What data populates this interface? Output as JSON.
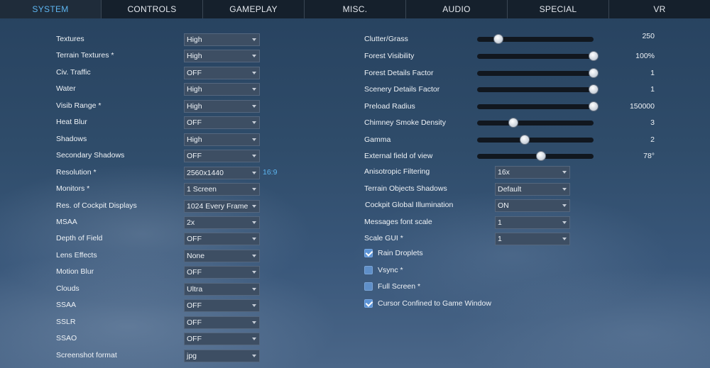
{
  "tabs": [
    "SYSTEM",
    "CONTROLS",
    "GAMEPLAY",
    "MISC.",
    "AUDIO",
    "SPECIAL",
    "VR"
  ],
  "left_options": [
    {
      "label": "Textures",
      "value": "High"
    },
    {
      "label": "Terrain Textures *",
      "value": "High"
    },
    {
      "label": "Civ. Traffic",
      "value": "OFF"
    },
    {
      "label": "Water",
      "value": "High"
    },
    {
      "label": "Visib Range *",
      "value": "High"
    },
    {
      "label": "Heat Blur",
      "value": "OFF"
    },
    {
      "label": "Shadows",
      "value": "High"
    },
    {
      "label": "Secondary Shadows",
      "value": "OFF"
    },
    {
      "label": "Resolution *",
      "value": "2560x1440"
    },
    {
      "label": "Monitors *",
      "value": "1 Screen"
    },
    {
      "label": "Res. of Cockpit Displays",
      "value": "1024 Every Frame"
    },
    {
      "label": "MSAA",
      "value": "2x"
    },
    {
      "label": "Depth of Field",
      "value": "OFF"
    },
    {
      "label": "Lens Effects",
      "value": "None"
    },
    {
      "label": "Motion Blur",
      "value": "OFF"
    },
    {
      "label": "Clouds",
      "value": "Ultra"
    },
    {
      "label": "SSAA",
      "value": "OFF"
    },
    {
      "label": "SSLR",
      "value": "OFF"
    },
    {
      "label": "SSAO",
      "value": "OFF"
    },
    {
      "label": "Screenshot format",
      "value": "jpg"
    }
  ],
  "aspect_ratio": "16:9",
  "sliders": [
    {
      "label": "Clutter/Grass",
      "value": "250",
      "level": 0.18
    },
    {
      "label": "Forest Visibility",
      "value": "100%",
      "level": 1.0
    },
    {
      "label": "Forest Details Factor",
      "value": "1",
      "level": 1.0
    },
    {
      "label": "Scenery Details Factor",
      "value": "1",
      "level": 1.0
    },
    {
      "label": "Preload Radius",
      "value": "150000",
      "level": 1.0
    },
    {
      "label": "Chimney Smoke Density",
      "value": "3",
      "level": 0.31
    },
    {
      "label": "Gamma",
      "value": "2",
      "level": 0.41
    },
    {
      "label": "External field of view",
      "value": "78°",
      "level": 0.55
    }
  ],
  "right_options": [
    {
      "label": "Anisotropic Filtering",
      "value": "16x"
    },
    {
      "label": "Terrain Objects Shadows",
      "value": "Default"
    },
    {
      "label": "Cockpit Global Illumination",
      "value": "ON"
    },
    {
      "label": "Messages font scale",
      "value": "1"
    },
    {
      "label": "Scale GUI *",
      "value": "1"
    }
  ],
  "checkboxes": [
    {
      "label": "Rain Droplets",
      "checked": true
    },
    {
      "label": "Vsync *",
      "checked": false
    },
    {
      "label": "Full Screen *",
      "checked": false
    },
    {
      "label": "Cursor Confined to Game Window",
      "checked": true
    }
  ]
}
